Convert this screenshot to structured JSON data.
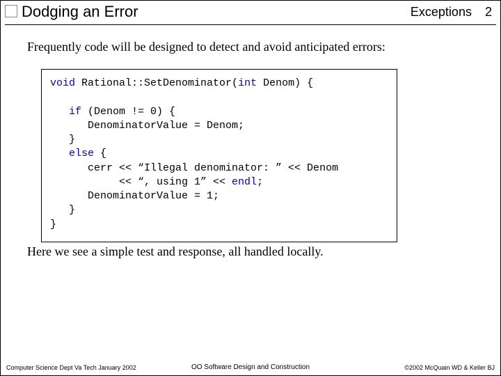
{
  "header": {
    "title": "Dodging an Error",
    "topic": "Exceptions",
    "page_number": "2"
  },
  "intro": "Frequently code will be designed to detect and avoid anticipated errors:",
  "code": {
    "l1a": "void",
    "l1b": " Rational::SetDenominator(",
    "l1c": "int",
    "l1d": " Denom) {",
    "blank1": "",
    "l2a": "   if",
    "l2b": " (Denom != 0) {",
    "l3": "      DenominatorValue = Denom;",
    "l4": "   }",
    "l5a": "   else",
    "l5b": " {",
    "l6": "      cerr << “Illegal denominator: ” << Denom",
    "l7a": "           << “, using 1” << ",
    "l7b": "endl",
    "l7c": ";",
    "l8": "      DenominatorValue = 1;",
    "l9": "   }",
    "l10": "}"
  },
  "outro": "Here we see a simple test and response, all handled locally.",
  "footer": {
    "left": "Computer Science Dept Va Tech January 2002",
    "center": "OO Software Design and Construction",
    "right": "©2002 McQuain WD & Keller BJ"
  }
}
